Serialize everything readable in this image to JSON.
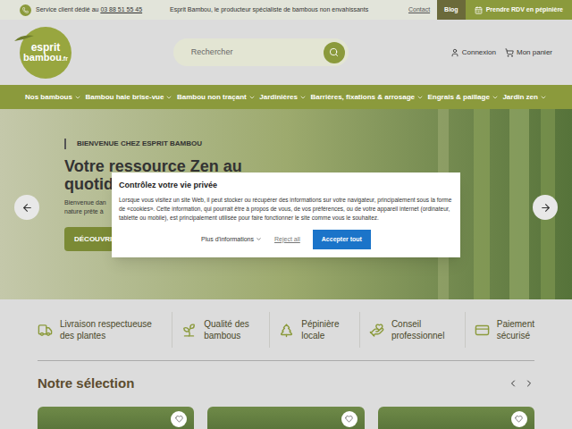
{
  "topbar": {
    "service": "Service client dédié au",
    "phone": "03 88 51 55 45",
    "tagline": "Esprit Bambou, le producteur spécialiste de bambous non envahissants",
    "contact": "Contact",
    "blog": "Blog",
    "appointment": "Prendre RDV en pépinière"
  },
  "logo": {
    "word1": "esprit",
    "word2": "bambou",
    "suffix": ".fr"
  },
  "search": {
    "placeholder": "Rechercher"
  },
  "account": {
    "login": "Connexion",
    "cart": "Mon panier"
  },
  "nav": [
    {
      "label": "Nos bambous"
    },
    {
      "label": "Bambou haie brise-vue"
    },
    {
      "label": "Bambou non traçant"
    },
    {
      "label": "Jardinières"
    },
    {
      "label": "Barrières, fixations & arrosage"
    },
    {
      "label": "Engrais & paillage"
    },
    {
      "label": "Jardin zen"
    }
  ],
  "hero": {
    "eyebrow": "BIENVENUE CHEZ ESPRIT BAMBOU",
    "title_lines": [
      "Votre ressource Zen au",
      "quotid"
    ],
    "text_lines": [
      "Bienvenue dan",
      "nature prête à"
    ],
    "button": "DÉCOUVRI"
  },
  "cookie": {
    "title": "Contrôlez votre vie privée",
    "body": "Lorsque vous visitez un site Web, il peut stocker ou récupérer des informations sur votre navigateur, principalement sous la forme de «cookies». Cette information, qui pourrait être à propos de vous, de vos préférences, ou de votre appareil internet (ordinateur, tablette ou mobile), est principalement utilisée pour faire fonctionner le site comme vous le souhaitez.",
    "more": "Plus d'informations",
    "reject": "Reject all",
    "accept": "Accepter tout"
  },
  "features": [
    {
      "lines": [
        "Livraison respectueuse",
        "des plantes"
      ]
    },
    {
      "lines": [
        "Qualité des",
        "bambous"
      ]
    },
    {
      "lines": [
        "Pépinière",
        "locale"
      ]
    },
    {
      "lines": [
        "Conseil",
        "professionnel"
      ]
    },
    {
      "lines": [
        "Paiement",
        "sécurisé"
      ]
    }
  ],
  "selection": {
    "title": "Notre sélection",
    "cards": [
      {
        "favorite": false
      },
      {
        "favorite": false
      },
      {
        "favorite": false
      }
    ]
  }
}
